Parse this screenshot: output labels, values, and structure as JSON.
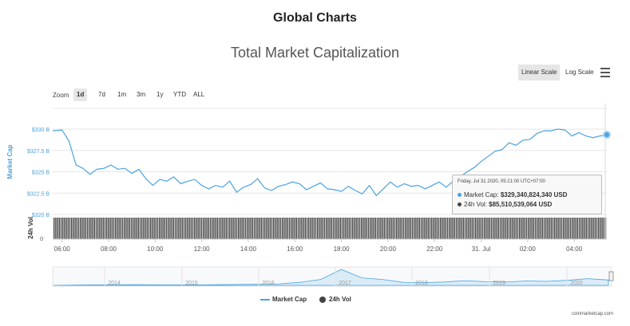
{
  "page_title": "Global Charts",
  "chart_title": "Total Market Capitalization",
  "scale_buttons": {
    "linear": "Linear Scale",
    "log": "Log Scale"
  },
  "zoom": {
    "label": "Zoom",
    "buttons": [
      "1d",
      "7d",
      "1m",
      "3m",
      "1y",
      "YTD",
      "ALL"
    ],
    "active": "1d"
  },
  "tooltip": {
    "date": "Friday, Jul 31 2020, 05:21:00 UTC+07:00",
    "market_cap_label": "Market Cap:",
    "market_cap_value": "$329,340,824,340 USD",
    "vol_label": "24h Vol:",
    "vol_value": "$85,510,539,064 USD"
  },
  "legend": {
    "market_cap": "Market Cap",
    "vol": "24h Vol"
  },
  "credit": "coinmarketcap.com",
  "colors": {
    "line": "#4aa3df",
    "volume": "#444444",
    "axis_label": "#4aa3df",
    "navigator": "#4aa3df"
  },
  "chart_data": {
    "type": "line",
    "ylabel": "Market Cap",
    "ylabel2": "24h Vol",
    "yticks": [
      "$320 B",
      "$322.5 B",
      "$325 B",
      "$327.5 B",
      "$330 B"
    ],
    "ylim": [
      320,
      330
    ],
    "y2ticks": [
      "0"
    ],
    "xticks": [
      "06:00",
      "08:00",
      "10:00",
      "12:00",
      "14:00",
      "16:00",
      "18:00",
      "20:00",
      "22:00",
      "31. Jul",
      "02:00",
      "04:00"
    ],
    "xlim": [
      5.6,
      29.4
    ],
    "series": [
      {
        "name": "Market Cap",
        "x": [
          5.6,
          6.0,
          6.3,
          6.6,
          6.9,
          7.2,
          7.5,
          7.8,
          8.1,
          8.4,
          8.7,
          9.0,
          9.3,
          9.6,
          9.9,
          10.2,
          10.5,
          10.8,
          11.1,
          11.4,
          11.7,
          12.0,
          12.3,
          12.6,
          12.9,
          13.2,
          13.5,
          13.8,
          14.1,
          14.4,
          14.7,
          15.0,
          15.3,
          15.6,
          15.9,
          16.2,
          16.5,
          16.8,
          17.1,
          17.4,
          17.7,
          18.0,
          18.3,
          18.6,
          18.9,
          19.2,
          19.5,
          19.8,
          20.1,
          20.4,
          20.7,
          21.0,
          21.3,
          21.6,
          21.9,
          22.2,
          22.5,
          22.8,
          23.1,
          23.4,
          23.7,
          24.0,
          24.3,
          24.6,
          24.9,
          25.2,
          25.5,
          25.8,
          26.1,
          26.4,
          26.7,
          27.0,
          27.3,
          27.6,
          27.9,
          28.2,
          28.5,
          28.8,
          29.1,
          29.4
        ],
        "values": [
          329.8,
          329.9,
          328.6,
          325.8,
          325.4,
          324.7,
          325.3,
          325.4,
          325.8,
          325.3,
          325.4,
          324.8,
          325.3,
          324.2,
          323.4,
          324.1,
          323.9,
          324.4,
          323.6,
          323.9,
          324.1,
          323.4,
          323.0,
          323.4,
          323.2,
          323.9,
          322.6,
          323.2,
          323.5,
          324.2,
          323.1,
          322.8,
          323.3,
          323.5,
          323.8,
          323.6,
          322.9,
          323.3,
          323.7,
          323.0,
          322.9,
          322.7,
          323.3,
          322.8,
          322.4,
          323.4,
          322.2,
          323.0,
          323.8,
          323.2,
          323.6,
          323.3,
          323.4,
          323.0,
          323.4,
          323.8,
          323.2,
          323.9,
          324.4,
          325.0,
          325.5,
          326.2,
          326.8,
          327.4,
          327.6,
          328.4,
          328.1,
          328.7,
          328.8,
          329.5,
          329.8,
          329.8,
          330.0,
          329.9,
          329.2,
          329.6,
          329.2,
          329.0,
          329.2,
          329.34
        ]
      },
      {
        "name": "24h Vol",
        "type": "column"
      }
    ],
    "navigator": {
      "years": [
        "2014",
        "2015",
        "2016",
        "2017",
        "2018",
        "2019",
        "2020"
      ]
    }
  }
}
